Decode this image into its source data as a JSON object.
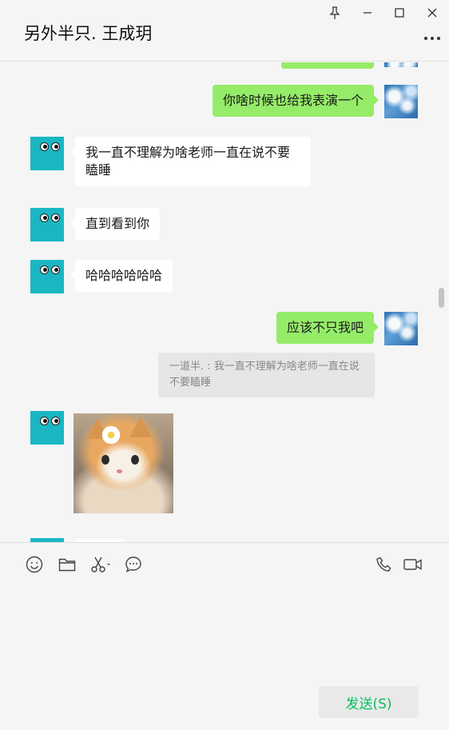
{
  "header": {
    "title": "另外半只. 王成玥"
  },
  "messages": {
    "m1": {
      "text": "你啥时候也给我表演一个"
    },
    "m2": {
      "text": "我一直不理解为啥老师一直在说不要瞌睡"
    },
    "m3": {
      "text": "直到看到你"
    },
    "m4": {
      "text": "哈哈哈哈哈哈"
    },
    "m5": {
      "text": "应该不只我吧"
    },
    "quote": {
      "text": "一道半. : 我一直不理解为啥老师一直在说不要瞌睡"
    }
  },
  "input": {
    "send_label": "发送(S)"
  },
  "colors": {
    "self_bubble": "#95ec69",
    "other_bubble": "#ffffff",
    "send_text": "#07c160",
    "avatar_teal": "#1ab7c3"
  }
}
